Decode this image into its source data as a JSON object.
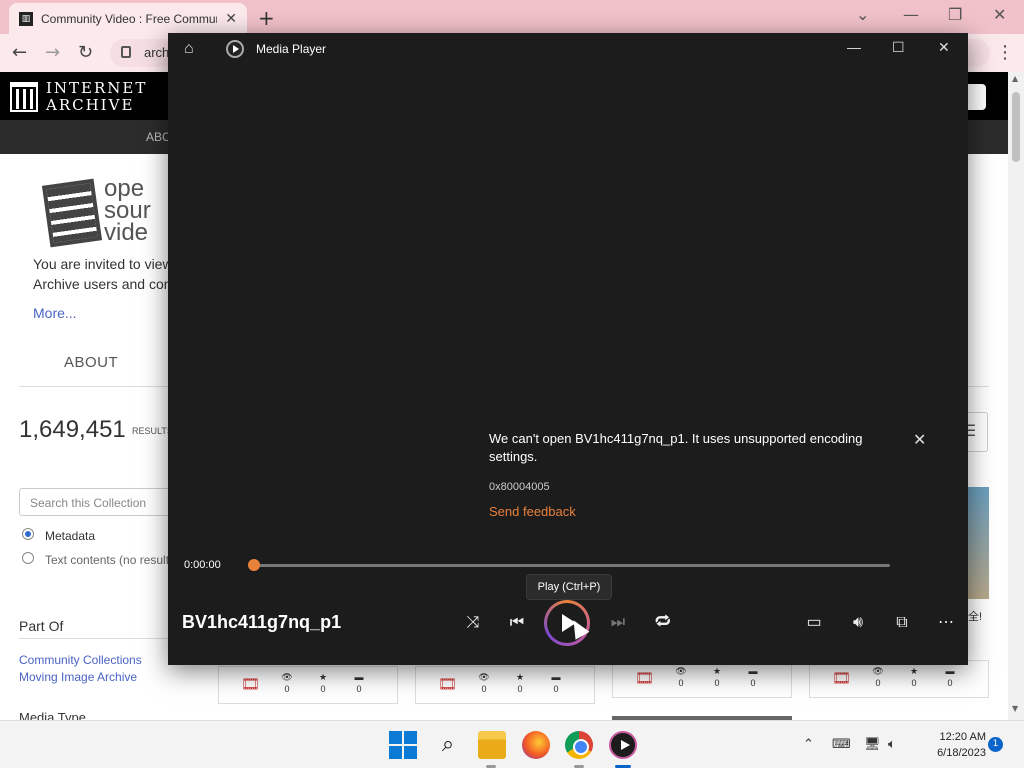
{
  "browser": {
    "tab_title": "Community Video : Free Community",
    "address": "archive.org",
    "new_tab_symbol": "+"
  },
  "site": {
    "logo_line1": "INTERNET",
    "logo_line2": "ARCHIVE",
    "nav_about": "ABO",
    "collection_logo_lines": [
      "ope",
      "sour",
      "vide"
    ],
    "invite_line1": "You are invited to view",
    "invite_line2": "Archive users and con",
    "more_link": "More...",
    "about_tab": "ABOUT",
    "results_count": "1,649,451",
    "results_label": "RESULTS",
    "search_placeholder": "Search this Collection",
    "radio_metadata": "Metadata",
    "radio_text": "Text contents (no results",
    "part_of": "Part Of",
    "link1": "Community Collections",
    "link2": "Moving Image Archive",
    "media_type": "Media Type",
    "thumb_text": "全!",
    "cards": [
      {
        "views": "0",
        "favs": "0",
        "comments": "0"
      },
      {
        "views": "0",
        "favs": "0",
        "comments": "0"
      },
      {
        "views": "0",
        "favs": "0",
        "comments": "0"
      },
      {
        "views": "0",
        "favs": "0",
        "comments": "0"
      }
    ]
  },
  "player": {
    "app_title": "Media Player",
    "error_message": "We can't open BV1hc411g7nq_p1. It uses unsupported encoding settings.",
    "error_code": "0x80004005",
    "feedback_link": "Send feedback",
    "current_time": "0:00:00",
    "tooltip": "Play (Ctrl+P)",
    "media_title": "BV1hc411g7nq_p1",
    "progress_fraction": 0,
    "accent": "#e8813a"
  },
  "taskbar": {
    "time": "12:20 AM",
    "date": "6/18/2023",
    "notifications": "1"
  }
}
